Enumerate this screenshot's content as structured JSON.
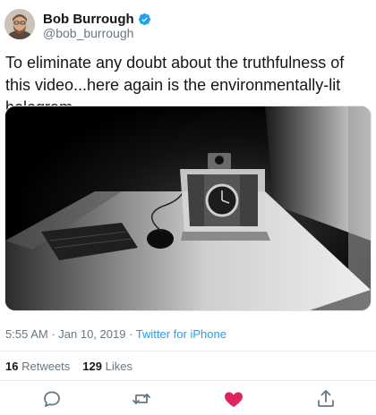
{
  "user": {
    "name": "Bob Burrough",
    "handle": "@bob_burrough"
  },
  "tweet": {
    "text": "To eliminate any doubt about the truthfulness of this video...here again is the environmentally-lit hologram."
  },
  "meta": {
    "time": "5:55 AM",
    "separator1": " · ",
    "date": "Jan 10, 2019",
    "separator2": " · ",
    "source": "Twitter for iPhone"
  },
  "stats": {
    "retweets_count": "16",
    "retweets_label": "Retweets",
    "likes_count": "129",
    "likes_label": "Likes"
  },
  "actions": {
    "reply_icon": "reply-icon",
    "retweet_icon": "retweet-icon",
    "like_icon": "heart-icon",
    "share_icon": "share-icon"
  },
  "colors": {
    "verified": "#1da1f2",
    "link": "#1da1f2",
    "like_active": "#e0245e",
    "icon": "#657786"
  }
}
